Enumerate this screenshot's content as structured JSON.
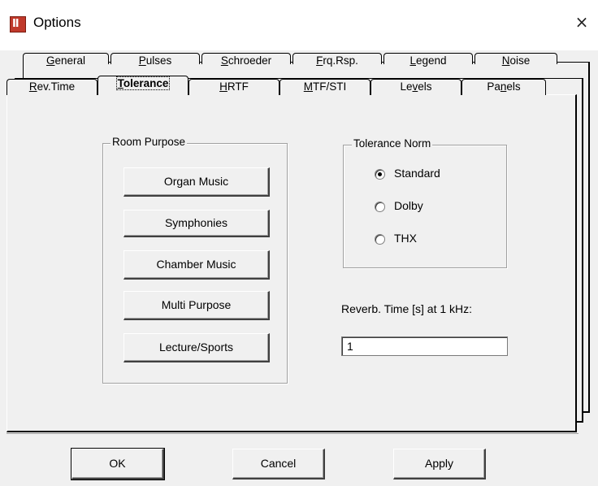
{
  "window": {
    "title": "Options",
    "close_glyph": "×",
    "app_icon": "app-logo-icon"
  },
  "tabs_back_row": [
    {
      "label": "General",
      "mnemonic": "G"
    },
    {
      "label": "Pulses",
      "mnemonic": "P"
    },
    {
      "label": "Schroeder",
      "mnemonic": "S"
    },
    {
      "label": "Frq.Rsp.",
      "mnemonic": "F"
    },
    {
      "label": "Legend",
      "mnemonic": "L"
    },
    {
      "label": "Noise",
      "mnemonic": "N"
    }
  ],
  "tabs_front_row": [
    {
      "label": "Rev.Time",
      "mnemonic": "R"
    },
    {
      "label": "Tolerance",
      "mnemonic": "T",
      "active": true
    },
    {
      "label": "HRTF",
      "mnemonic": "H"
    },
    {
      "label": "MTF/STI",
      "mnemonic": "M"
    },
    {
      "label": "Levels",
      "mnemonic": "v"
    },
    {
      "label": "Panels",
      "mnemonic": "n"
    }
  ],
  "room_purpose": {
    "title": "Room Purpose",
    "buttons": [
      "Organ Music",
      "Symphonies",
      "Chamber Music",
      "Multi Purpose",
      "Lecture/Sports"
    ]
  },
  "tolerance_norm": {
    "title": "Tolerance Norm",
    "options": [
      {
        "label": "Standard",
        "selected": true
      },
      {
        "label": "Dolby",
        "selected": false
      },
      {
        "label": "THX",
        "selected": false
      }
    ]
  },
  "reverb": {
    "label": "Reverb. Time [s] at 1 kHz:",
    "value": "1"
  },
  "footer": {
    "ok": "OK",
    "cancel": "Cancel",
    "apply": "Apply"
  },
  "colors": {
    "face": "#f0f0f0",
    "icon": "#c0392b"
  }
}
